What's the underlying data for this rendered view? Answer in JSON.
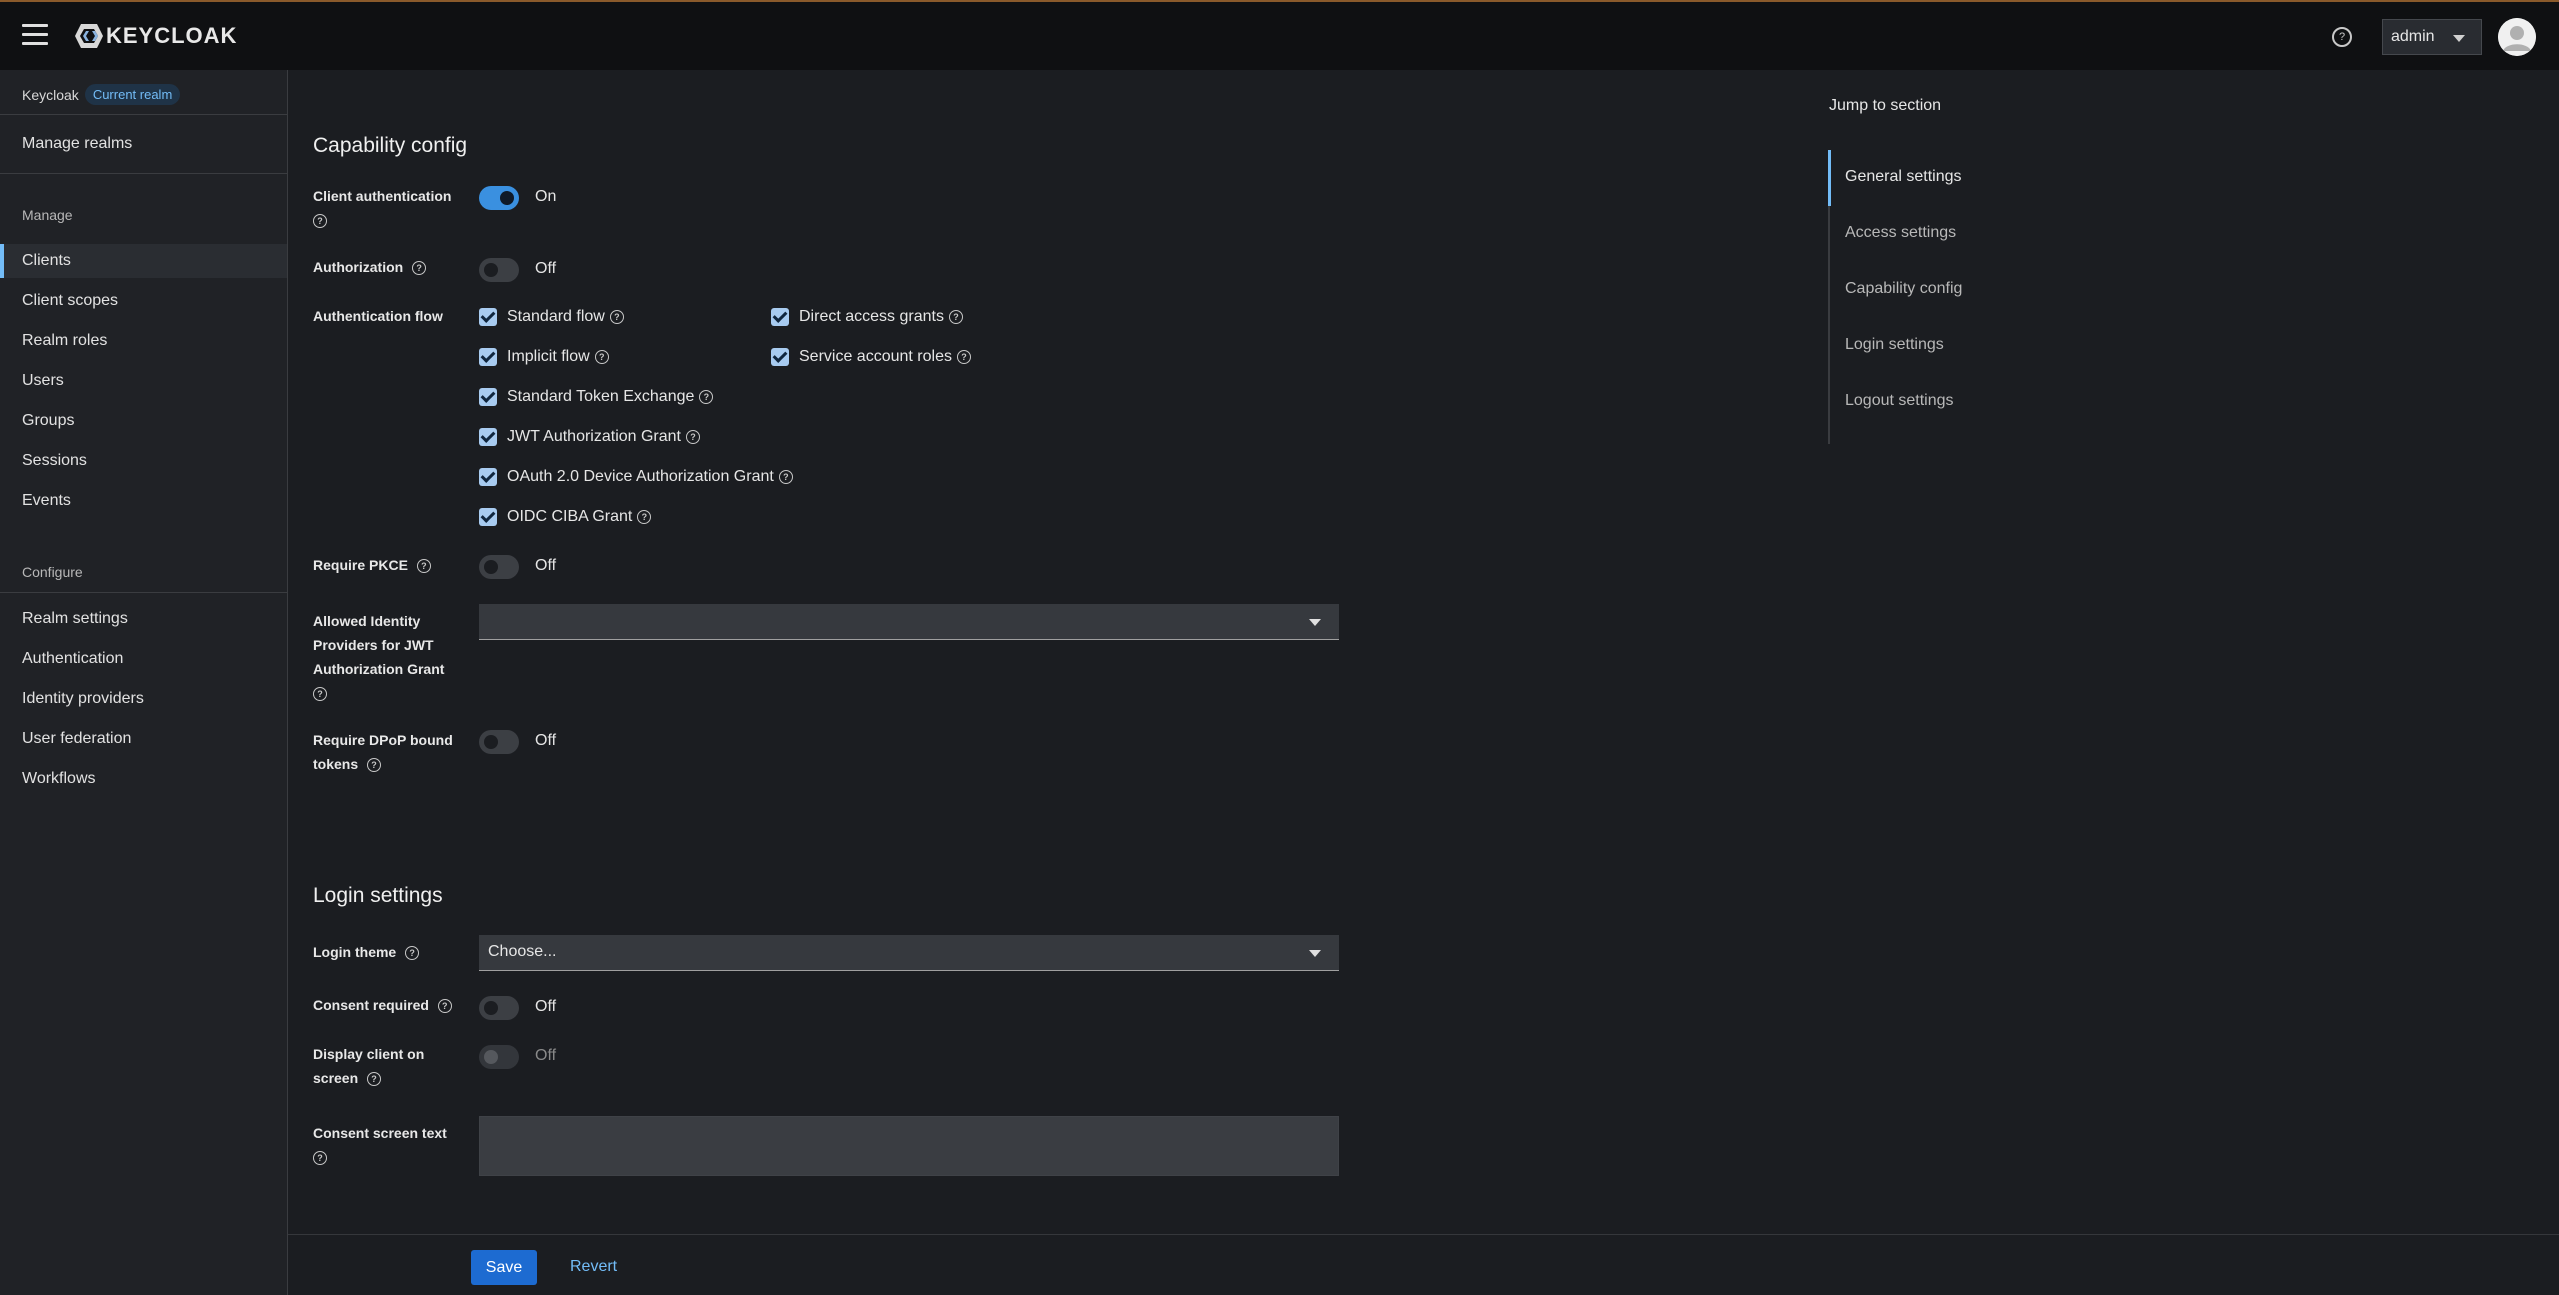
{
  "header": {
    "logo_text": "KEYCLOAK",
    "help_glyph": "?",
    "user_label": "admin",
    "icons": [
      "menu-icon",
      "keycloak-logo-icon",
      "help-icon",
      "caret-down-icon",
      "user-avatar-icon"
    ]
  },
  "sidebar": {
    "realm_name": "Keycloak",
    "realm_badge": "Current realm",
    "manage_realms": "Manage realms",
    "manage_heading": "Manage",
    "manage_items": [
      "Clients",
      "Client scopes",
      "Realm roles",
      "Users",
      "Groups",
      "Sessions",
      "Events"
    ],
    "active_item": "Clients",
    "configure_heading": "Configure",
    "configure_items": [
      "Realm settings",
      "Authentication",
      "Identity providers",
      "User federation",
      "Workflows"
    ]
  },
  "capability": {
    "title": "Capability config",
    "client_auth_label": "Client authentication",
    "client_auth_value": "On",
    "authorization_label": "Authorization",
    "authorization_value": "Off",
    "auth_flow_label": "Authentication flow",
    "flows": {
      "standard_flow": "Standard flow",
      "direct_access": "Direct access grants",
      "implicit_flow": "Implicit flow",
      "service_account": "Service account roles",
      "token_exchange": "Standard Token Exchange",
      "jwt_grant": "JWT Authorization Grant",
      "device_grant": "OAuth 2.0 Device Authorization Grant",
      "ciba_grant": "OIDC CIBA Grant"
    },
    "pkce_label": "Require PKCE",
    "pkce_value": "Off",
    "idp_label_1": "Allowed Identity",
    "idp_label_2": "Providers for JWT",
    "idp_label_3": "Authorization Grant",
    "idp_value": "",
    "dpop_label_1": "Require DPoP bound",
    "dpop_label_2": "tokens",
    "dpop_value": "Off"
  },
  "login": {
    "title": "Login settings",
    "theme_label": "Login theme",
    "theme_value": "Choose...",
    "consent_label": "Consent required",
    "consent_value": "Off",
    "display_label_1": "Display client on",
    "display_label_2": "screen",
    "display_value": "Off",
    "consent_text_label": "Consent screen text",
    "consent_text_value": ""
  },
  "footer": {
    "save_label": "Save",
    "revert_label": "Revert"
  },
  "jump": {
    "title": "Jump to section",
    "items": [
      "General settings",
      "Access settings",
      "Capability config",
      "Login settings",
      "Logout settings"
    ],
    "active": "General settings"
  },
  "colors": {
    "accent": "#73bcf7",
    "toggle_on": "#3a90e0",
    "primary_button": "#1d6bd1",
    "background": "#1b1d21"
  }
}
